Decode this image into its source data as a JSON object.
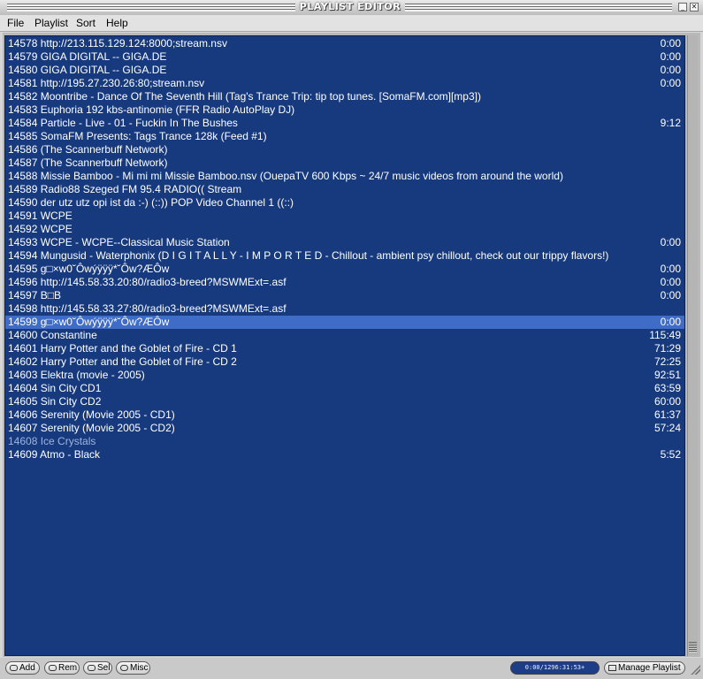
{
  "window": {
    "title": "PLAYLIST EDITOR",
    "min_icon": "minimize-icon",
    "close_icon": "close-icon"
  },
  "menu": [
    {
      "label": "File"
    },
    {
      "label": "Playlist"
    },
    {
      "label": "Sort"
    },
    {
      "label": "Help"
    }
  ],
  "playlist": {
    "colors": {
      "background": "#173a7e",
      "selected": "#3e6cc7",
      "text": "#ffffff",
      "dim_text": "#9db4df"
    },
    "selected_index": 21,
    "rows": [
      {
        "title": "14578 http://213.115.129.124:8000;stream.nsv",
        "duration": "0:00"
      },
      {
        "title": "14579 GIGA DIGITAL -- GIGA.DE",
        "duration": "0:00"
      },
      {
        "title": "14580 GIGA DIGITAL -- GIGA.DE",
        "duration": "0:00"
      },
      {
        "title": "14581 http://195.27.230.26:80;stream.nsv",
        "duration": "0:00"
      },
      {
        "title": "14582 Moontribe - Dance Of The Seventh Hill (Tag's Trance Trip: tip top tunes. [SomaFM.com][mp3])",
        "duration": ""
      },
      {
        "title": "14583 Euphoria 192 kbs-antinomie (FFR Radio AutoPlay DJ)",
        "duration": ""
      },
      {
        "title": "14584 Particle - Live - 01 - Fuckin In The Bushes",
        "duration": "9:12"
      },
      {
        "title": "14585 SomaFM Presents: Tags Trance 128k (Feed #1)",
        "duration": ""
      },
      {
        "title": "14586  (The Scannerbuff Network)",
        "duration": ""
      },
      {
        "title": "14587  (The Scannerbuff Network)",
        "duration": ""
      },
      {
        "title": "14588 Missie Bamboo - Mi mi mi Missie Bamboo.nsv (OuepaTV 600 Kbps ~ 24/7 music videos from around the world)",
        "duration": ""
      },
      {
        "title": "14589 Radio88 Szeged FM 95.4 RADIO(( Stream",
        "duration": ""
      },
      {
        "title": "14590 der utz utz opi ist da :-) (::)) POP Video Channel 1 ((::)",
        "duration": ""
      },
      {
        "title": "14591 WCPE",
        "duration": ""
      },
      {
        "title": "14592 WCPE",
        "duration": ""
      },
      {
        "title": "14593 WCPE - WCPE--Classical Music Station",
        "duration": "0:00"
      },
      {
        "title": "14594 Mungusid - Waterphonix (D I G I T A L L Y - I M P O R T E D - Chillout - ambient psy chillout, check out our trippy flavors!)",
        "duration": ""
      },
      {
        "title": "14595 g□×w0˘Ôwýÿÿÿ*˘Ôw?ÆÔw",
        "duration": "0:00"
      },
      {
        "title": "14596 http://145.58.33.20:80/radio3-breed?MSWMExt=.asf",
        "duration": "0:00"
      },
      {
        "title": "14597 B□B",
        "duration": "0:00"
      },
      {
        "title": "14598 http://145.58.33.27:80/radio3-breed?MSWMExt=.asf",
        "duration": ""
      },
      {
        "title": "14599 g□×w0˘Ôwýÿÿÿ*˘Ôw?ÆÔw",
        "duration": "0:00"
      },
      {
        "title": "14600 Constantine",
        "duration": "115:49"
      },
      {
        "title": "14601 Harry Potter and the Goblet of Fire - CD 1",
        "duration": "71:29"
      },
      {
        "title": "14602 Harry Potter and the Goblet of Fire - CD 2",
        "duration": "72:25"
      },
      {
        "title": "14603 Elektra (movie - 2005)",
        "duration": "92:51"
      },
      {
        "title": "14604 Sin City CD1",
        "duration": "63:59"
      },
      {
        "title": "14605 Sin City CD2",
        "duration": "60:00"
      },
      {
        "title": "14606 Serenity (Movie 2005 - CD1)",
        "duration": "61:37"
      },
      {
        "title": "14607 Serenity (Movie 2005 - CD2)",
        "duration": "57:24"
      },
      {
        "title": "14608 Ice Crystals",
        "duration": "",
        "dim": true
      },
      {
        "title": "14609 Atmo - Black",
        "duration": "5:52"
      }
    ]
  },
  "bottom": {
    "add_label": "Add",
    "rem_label": "Rem",
    "sel_label": "Sel",
    "misc_label": "Misc",
    "time_display": "0:00/1296:31:53+",
    "manage_label": "Manage Playlist",
    "icons": {
      "add": "add-icon",
      "rem": "remove-icon",
      "sel": "select-icon",
      "misc": "misc-icon",
      "manage": "folder-icon"
    }
  }
}
